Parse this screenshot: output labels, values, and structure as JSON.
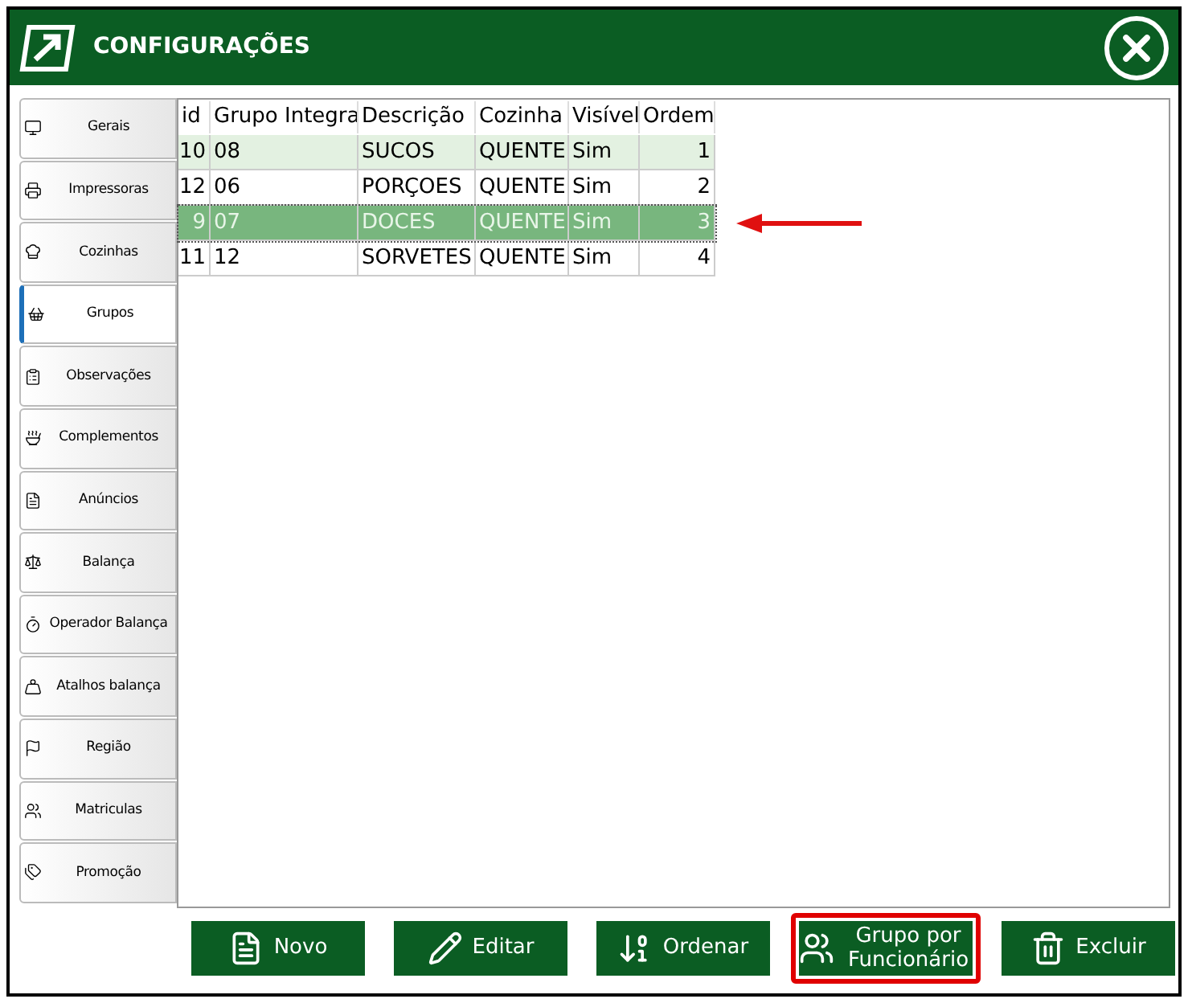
{
  "window": {
    "title": "CONFIGURAÇÕES"
  },
  "sidebar": {
    "items": [
      {
        "label": "Gerais",
        "selected": false
      },
      {
        "label": "Impressoras",
        "selected": false
      },
      {
        "label": "Cozinhas",
        "selected": false
      },
      {
        "label": "Grupos",
        "selected": true
      },
      {
        "label": "Observações",
        "selected": false
      },
      {
        "label": "Complementos",
        "selected": false
      },
      {
        "label": "Anúncios",
        "selected": false
      },
      {
        "label": "Balança",
        "selected": false
      },
      {
        "label": "Operador  Balança",
        "selected": false
      },
      {
        "label": "Atalhos balança",
        "selected": false
      },
      {
        "label": "Região",
        "selected": false
      },
      {
        "label": "Matriculas",
        "selected": false
      },
      {
        "label": "Promoção",
        "selected": false
      }
    ]
  },
  "table": {
    "columns": [
      "id",
      "Grupo Integra",
      "Descrição",
      "Cozinha",
      "Visível",
      "Ordem"
    ],
    "rows": [
      {
        "cells": [
          "10",
          "08",
          "SUCOS",
          "QUENTE",
          "Sim",
          "1"
        ],
        "selected": false
      },
      {
        "cells": [
          "12",
          "06",
          "PORÇOES",
          "QUENTE",
          "Sim",
          "2"
        ],
        "selected": false
      },
      {
        "cells": [
          "9",
          "07",
          "DOCES",
          "QUENTE",
          "Sim",
          "3"
        ],
        "selected": true
      },
      {
        "cells": [
          "11",
          "12",
          "SORVETES",
          "QUENTE",
          "Sim",
          "4"
        ],
        "selected": false
      }
    ]
  },
  "buttons": [
    {
      "label": "Novo",
      "highlighted": false
    },
    {
      "label": "Editar",
      "highlighted": false
    },
    {
      "label": "Ordenar",
      "highlighted": false
    },
    {
      "label": "Grupo por Funcionário",
      "highlighted": true
    },
    {
      "label": "Excluir",
      "highlighted": false
    }
  ]
}
